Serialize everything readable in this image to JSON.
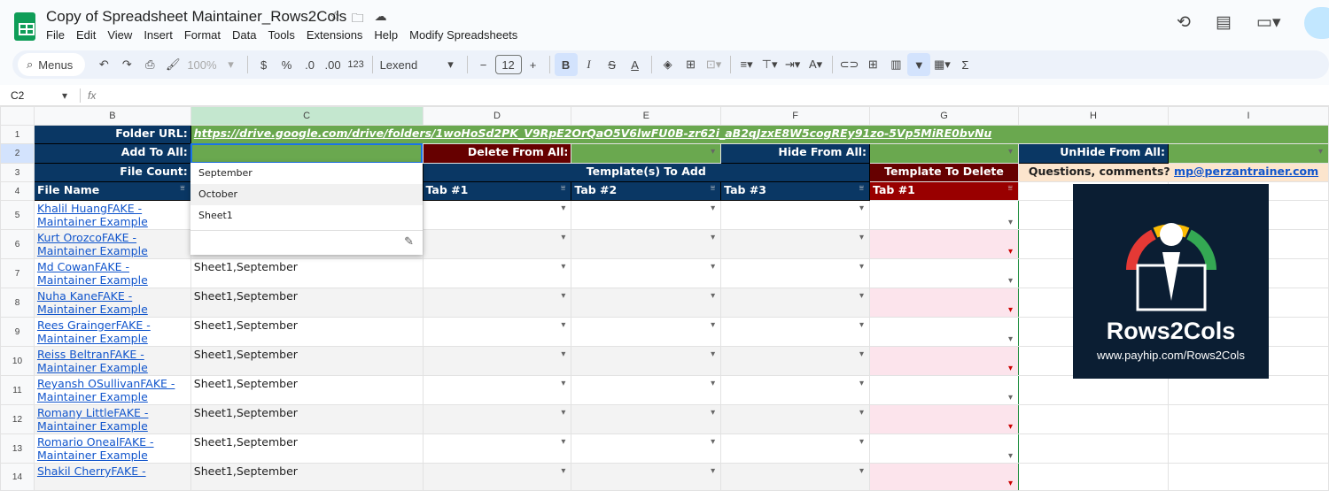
{
  "doc": {
    "title": "Copy of Spreadsheet Maintainer_Rows2Cols",
    "menu": [
      "File",
      "Edit",
      "View",
      "Insert",
      "Format",
      "Data",
      "Tools",
      "Extensions",
      "Help",
      "Modify Spreadsheets"
    ]
  },
  "toolbar": {
    "search": "Menus",
    "zoom": "100%",
    "currency": "$",
    "percent": "%",
    "dec_dec": ".0",
    "inc_dec": ".00",
    "format": "123",
    "font": "Lexend",
    "font_size": "12"
  },
  "formula_bar": {
    "cell_ref": "C2",
    "fx": "fx"
  },
  "columns": [
    "",
    "B",
    "C",
    "D",
    "E",
    "F",
    "G",
    "H",
    "I"
  ],
  "rows_hdr": {
    "r1": "1",
    "r2": "2",
    "r3": "3",
    "r4": "4"
  },
  "sheet": {
    "folder_label": "Folder URL:",
    "folder_url": "https://drive.google.com/drive/folders/1woHoSd2PK_V9RpE2OrQaO5V6lwFU0B-zr62i_aB2qJzxE8W5cogREy91zo-5Vp5MiRE0bvNu",
    "add_label": "Add To All:",
    "delete_label": "Delete From All:",
    "hide_label": "Hide From All:",
    "unhide_label": "UnHide From All:",
    "count_label": "File Count:",
    "templates_add": "Template(s) To Add",
    "template_delete": "Template To Delete",
    "questions": "Questions, comments?",
    "email": "mp@perzantrainer.com",
    "file_name_hdr": "File Name",
    "tab1": "Tab #1",
    "tab2": "Tab #2",
    "tab3": "Tab #3",
    "gtab1": "Tab #1",
    "rows": [
      {
        "n": "5",
        "name": "Khalil HuangFAKE - Maintainer Example",
        "tabs": ""
      },
      {
        "n": "6",
        "name": "Kurt OrozcoFAKE - Maintainer Example",
        "tabs": ""
      },
      {
        "n": "7",
        "name": "Md CowanFAKE - Maintainer Example",
        "tabs": "Sheet1,September"
      },
      {
        "n": "8",
        "name": "Nuha KaneFAKE - Maintainer Example",
        "tabs": "Sheet1,September"
      },
      {
        "n": "9",
        "name": "Rees GraingerFAKE - Maintainer Example",
        "tabs": "Sheet1,September"
      },
      {
        "n": "10",
        "name": "Reiss BeltranFAKE - Maintainer Example",
        "tabs": "Sheet1,September"
      },
      {
        "n": "11",
        "name": "Reyansh OSullivanFAKE - Maintainer Example",
        "tabs": "Sheet1,September"
      },
      {
        "n": "12",
        "name": "Romany LittleFAKE - Maintainer Example",
        "tabs": "Sheet1,September"
      },
      {
        "n": "13",
        "name": "Romario OnealFAKE - Maintainer Example",
        "tabs": "Sheet1,September"
      },
      {
        "n": "14",
        "name": "Shakil CherryFAKE -",
        "tabs": "Sheet1,September"
      }
    ]
  },
  "dropdown": {
    "options": [
      "September",
      "October",
      "Sheet1"
    ]
  },
  "brand": {
    "name": "Rows2Cols",
    "url": "www.payhip.com/Rows2Cols"
  }
}
